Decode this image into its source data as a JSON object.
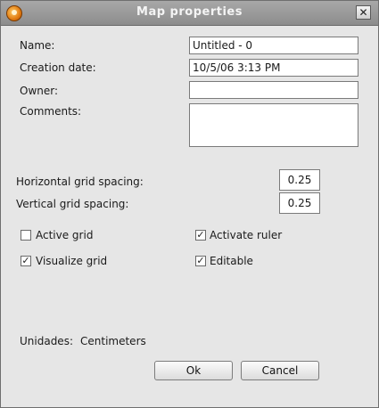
{
  "window": {
    "title": "Map properties",
    "close_glyph": "✕",
    "app_icon": "gvsig-icon"
  },
  "form": {
    "name_label": "Name:",
    "name_value": "Untitled - 0",
    "creation_date_label": "Creation date:",
    "creation_date_value": "10/5/06 3:13 PM",
    "owner_label": "Owner:",
    "owner_value": "",
    "comments_label": "Comments:",
    "comments_value": ""
  },
  "grid": {
    "horizontal_label": "Horizontal grid spacing:",
    "horizontal_value": "0.25",
    "vertical_label": "Vertical grid spacing:",
    "vertical_value": "0.25"
  },
  "options": {
    "active_grid": {
      "label": "Active grid",
      "checked": false
    },
    "activate_ruler": {
      "label": "Activate ruler",
      "checked": true
    },
    "visualize_grid": {
      "label": "Visualize grid",
      "checked": true
    },
    "editable": {
      "label": "Editable",
      "checked": true
    }
  },
  "units": {
    "label": "Unidades:",
    "value": "Centimeters"
  },
  "buttons": {
    "ok": "Ok",
    "cancel": "Cancel"
  },
  "check_glyph": "✓"
}
